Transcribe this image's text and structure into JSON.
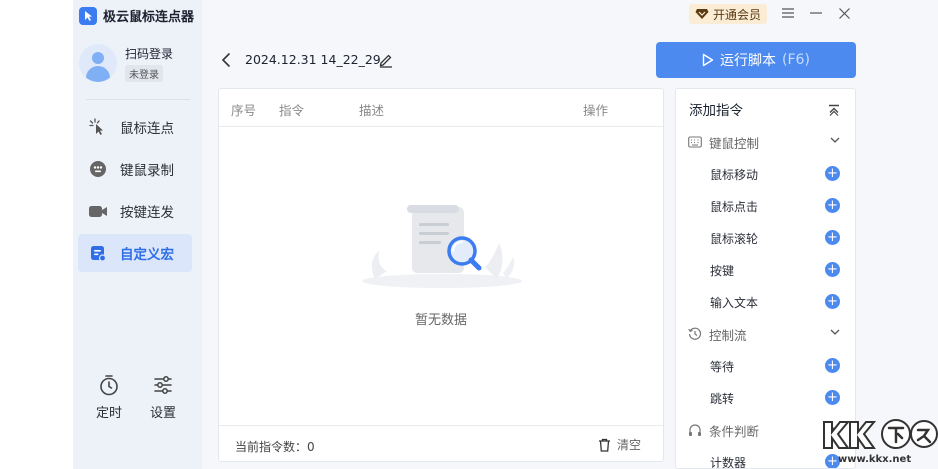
{
  "app": {
    "title": "极云鼠标连点器",
    "accent": "#4d8af0"
  },
  "user": {
    "name": "扫码登录",
    "status": "未登录"
  },
  "nav": [
    {
      "label": "鼠标连点",
      "icon": "cursor-click-icon",
      "active": false
    },
    {
      "label": "键鼠录制",
      "icon": "record-icon",
      "active": false
    },
    {
      "label": "按键连发",
      "icon": "camera-icon",
      "active": false
    },
    {
      "label": "自定义宏",
      "icon": "macro-icon",
      "active": true
    }
  ],
  "bottom_tools": [
    {
      "label": "定时",
      "icon": "timer-icon"
    },
    {
      "label": "设置",
      "icon": "sliders-icon"
    }
  ],
  "topbar": {
    "vip_label": "开通会员"
  },
  "header": {
    "script_name": "2024.12.31 14_22_29",
    "run_label": "运行脚本",
    "run_hint": "(F6)"
  },
  "table": {
    "columns": [
      "序号",
      "指令",
      "描述",
      "操作"
    ],
    "empty_text": "暂无数据",
    "count_label": "当前指令数：0",
    "clear_label": "清空"
  },
  "commands": {
    "title": "添加指令",
    "groups": [
      {
        "label": "键鼠控制",
        "icon": "keyboard-icon",
        "items": [
          "鼠标移动",
          "鼠标点击",
          "鼠标滚轮",
          "按键",
          "输入文本"
        ]
      },
      {
        "label": "控制流",
        "icon": "history-icon",
        "items": [
          "等待",
          "跳转"
        ]
      },
      {
        "label": "条件判断",
        "icon": "headphone-icon",
        "items": [
          "计数器"
        ]
      }
    ]
  },
  "watermark": {
    "site": "www.kkx.net"
  }
}
